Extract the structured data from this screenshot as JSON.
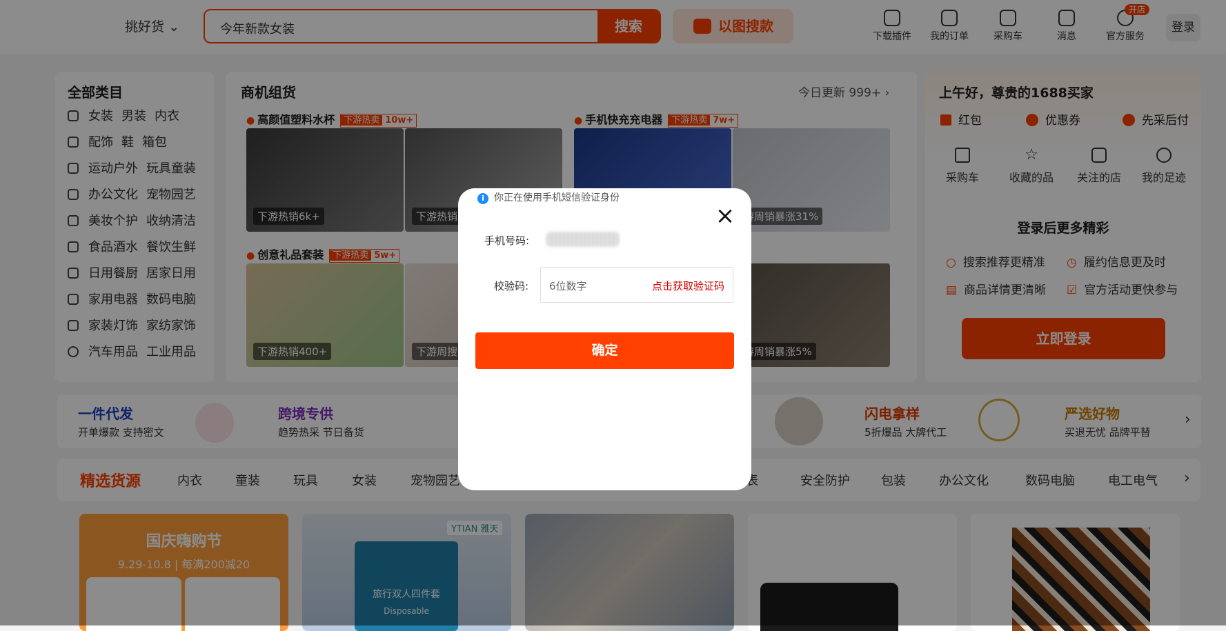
{
  "header": {
    "pick_label": "挑好货",
    "search_query": "今年新款女装",
    "search_button": "搜索",
    "image_search": "以图搜款",
    "icons": [
      {
        "label": "下载插件",
        "icon": "plugin-icon"
      },
      {
        "label": "我的订单",
        "icon": "order-icon"
      },
      {
        "label": "采购车",
        "icon": "cart-icon"
      },
      {
        "label": "消息",
        "icon": "message-icon"
      },
      {
        "label": "官方服务",
        "icon": "service-icon"
      }
    ],
    "open_badge": "开店",
    "login": "登录"
  },
  "categories": {
    "title": "全部类目",
    "rows": [
      [
        "女装",
        "男装",
        "内衣"
      ],
      [
        "配饰",
        "鞋",
        "箱包"
      ],
      [
        "运动户外",
        "玩具童装"
      ],
      [
        "办公文化",
        "宠物园艺"
      ],
      [
        "美妆个护",
        "收纳清洁"
      ],
      [
        "食品酒水",
        "餐饮生鲜"
      ],
      [
        "日用餐厨",
        "居家日用"
      ],
      [
        "家用电器",
        "数码电脑"
      ],
      [
        "家装灯饰",
        "家纺家饰"
      ],
      [
        "汽车用品",
        "工业用品"
      ]
    ]
  },
  "opportunity": {
    "title": "商机组货",
    "update": "今日更新 999+",
    "groups": [
      {
        "name": "高颜值塑料水杯",
        "hot": "下游热卖",
        "count": "10w+",
        "tags": [
          "下游热销6k+",
          "下游热销"
        ]
      },
      {
        "name": "手机快充充电器",
        "hot": "下游热卖",
        "count": "7w+",
        "tags": [
          "",
          "游周销暴涨31%"
        ]
      },
      {
        "name": "创意礼品套装",
        "hot": "下游热卖",
        "count": "5w+",
        "tags": [
          "下游热销400+",
          "下游周搜"
        ]
      },
      {
        "name": "",
        "hot": "",
        "count": "",
        "tags": [
          "",
          "游周销暴涨5%"
        ]
      }
    ]
  },
  "account": {
    "greeting": "上午好，尊贵的1688买家",
    "benefits": [
      "红包",
      "优惠券",
      "先采后付"
    ],
    "shortcuts": [
      "采购车",
      "收藏的品",
      "关注的店",
      "我的足迹"
    ],
    "more_title": "登录后更多精彩",
    "features": [
      "搜索推荐更精准",
      "履约信息更及时",
      "商品详情更清晰",
      "官方活动更快参与"
    ],
    "login_button": "立即登录"
  },
  "strips": [
    {
      "title": "一件代发",
      "sub": "开单爆款 支持密文",
      "color": "#1a3fbf"
    },
    {
      "title": "跨境专供",
      "sub": "趋势热采 节日备货",
      "color": "#7b2fbf"
    },
    {
      "title": "闪电拿样",
      "sub": "5折爆品 大牌代工",
      "color": "#e03a00"
    },
    {
      "title": "严选好物",
      "sub": "买退无忧 品牌平替",
      "color": "#c77a00"
    }
  ],
  "tabs": {
    "active": "精选货源",
    "items": [
      "内衣",
      "童装",
      "玩具",
      "女装",
      "宠物园艺",
      "腕表",
      "安全防护",
      "包装",
      "办公文化",
      "数码电脑",
      "电工电气"
    ]
  },
  "tiles": {
    "promo_title": "国庆嗨购节",
    "promo_sub": "9.29-10.8 | 每满200减20",
    "brand": "YTIAN 雅天",
    "pack_title": "旅行双人四件套",
    "pack_sub": "Disposable"
  },
  "modal": {
    "info": "你正在使用手机短信验证身份",
    "phone_label": "手机号码:",
    "code_label": "校验码:",
    "code_placeholder": "6位数字",
    "get_code": "点击获取验证码",
    "confirm": "确定"
  }
}
